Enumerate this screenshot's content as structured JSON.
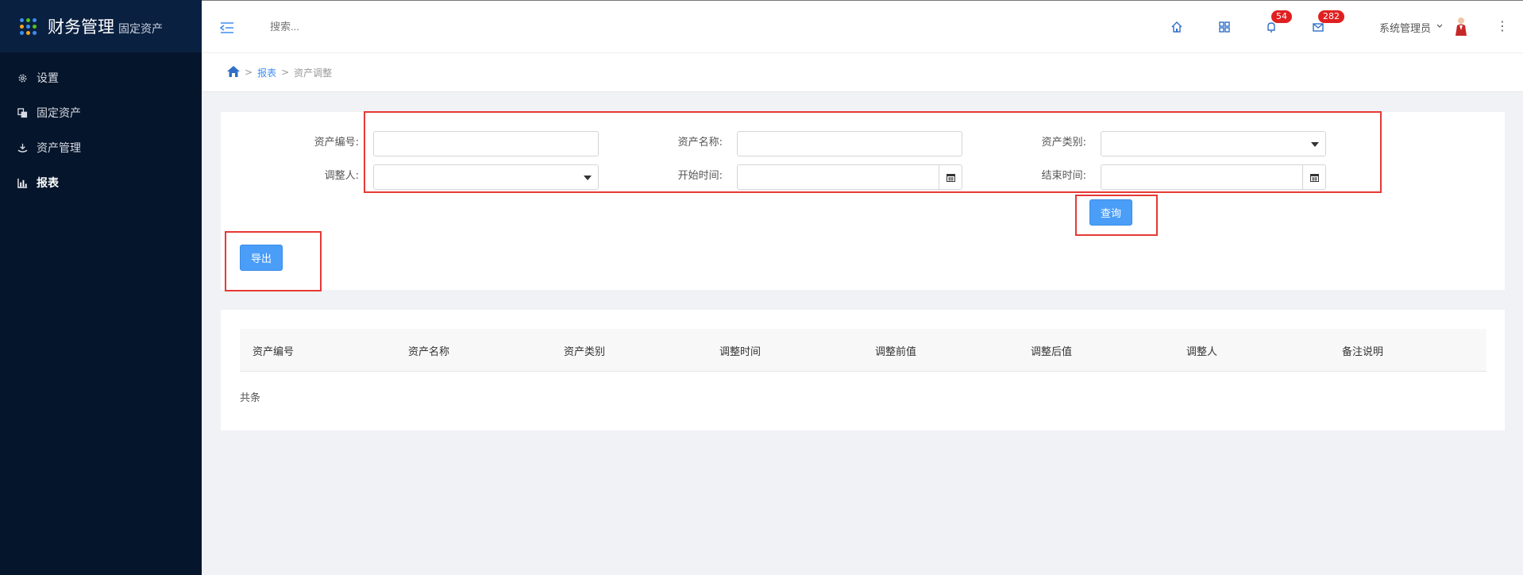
{
  "brand": {
    "title": "财务管理",
    "subtitle": "固定资产"
  },
  "sidebar": {
    "items": [
      {
        "label": "设置",
        "icon": "gear-icon"
      },
      {
        "label": "固定资产",
        "icon": "assets-icon"
      },
      {
        "label": "资产管理",
        "icon": "asset-manage-icon"
      },
      {
        "label": "报表",
        "icon": "bar-chart-icon",
        "active": true
      }
    ]
  },
  "header": {
    "search_placeholder": "搜索...",
    "notifications_count": "54",
    "messages_count": "282",
    "user_name": "系统管理员"
  },
  "breadcrumb": {
    "level1": "报表",
    "level2": "资产调整"
  },
  "filters": {
    "asset_code_label": "资产编号:",
    "asset_name_label": "资产名称:",
    "asset_category_label": "资产类别:",
    "adjuster_label": "调整人:",
    "start_time_label": "开始时间:",
    "end_time_label": "结束时间:",
    "query_button": "查询",
    "export_button": "导出"
  },
  "table": {
    "columns": [
      "资产编号",
      "资产名称",
      "资产类别",
      "调整时间",
      "调整前值",
      "调整后值",
      "调整人",
      "备注说明"
    ],
    "total_text": "共条"
  },
  "colors": {
    "sidebar_bg": "#05152b",
    "accent": "#4a9ef8",
    "highlight": "#e53935",
    "badge": "#e02020"
  }
}
